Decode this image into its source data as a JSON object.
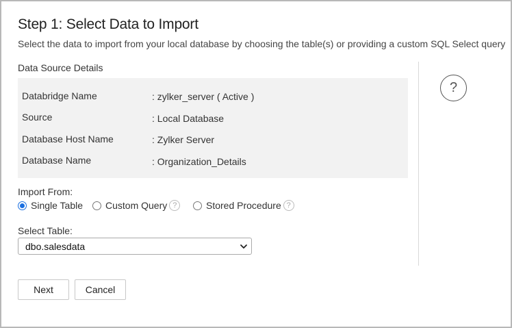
{
  "header": {
    "title": "Step 1: Select Data to Import",
    "subtitle": "Select the data to import from your local database by choosing the table(s) or providing a custom SQL Select query"
  },
  "data_source": {
    "label": "Data Source Details",
    "rows": [
      {
        "key": "Databridge Name",
        "value": ": zylker_server ( Active )"
      },
      {
        "key": "Source",
        "value": ": Local Database"
      },
      {
        "key": "Database Host Name",
        "value": ": Zylker Server"
      },
      {
        "key": "Database Name",
        "value": ": Organization_Details"
      }
    ]
  },
  "help": {
    "icon": "question-mark",
    "glyph": "?"
  },
  "import_from": {
    "label": "Import From:",
    "options": [
      {
        "label": "Single Table",
        "selected": true
      },
      {
        "label": "Custom Query",
        "selected": false,
        "help": "?"
      },
      {
        "label": "Stored Procedure",
        "selected": false,
        "help": "?"
      }
    ]
  },
  "select_table": {
    "label": "Select Table:",
    "value": "dbo.salesdata"
  },
  "buttons": {
    "next": "Next",
    "cancel": "Cancel"
  },
  "colors": {
    "accent": "#1a6fe0",
    "panel_bg": "#f2f2f2",
    "border": "#b8b8b8"
  }
}
